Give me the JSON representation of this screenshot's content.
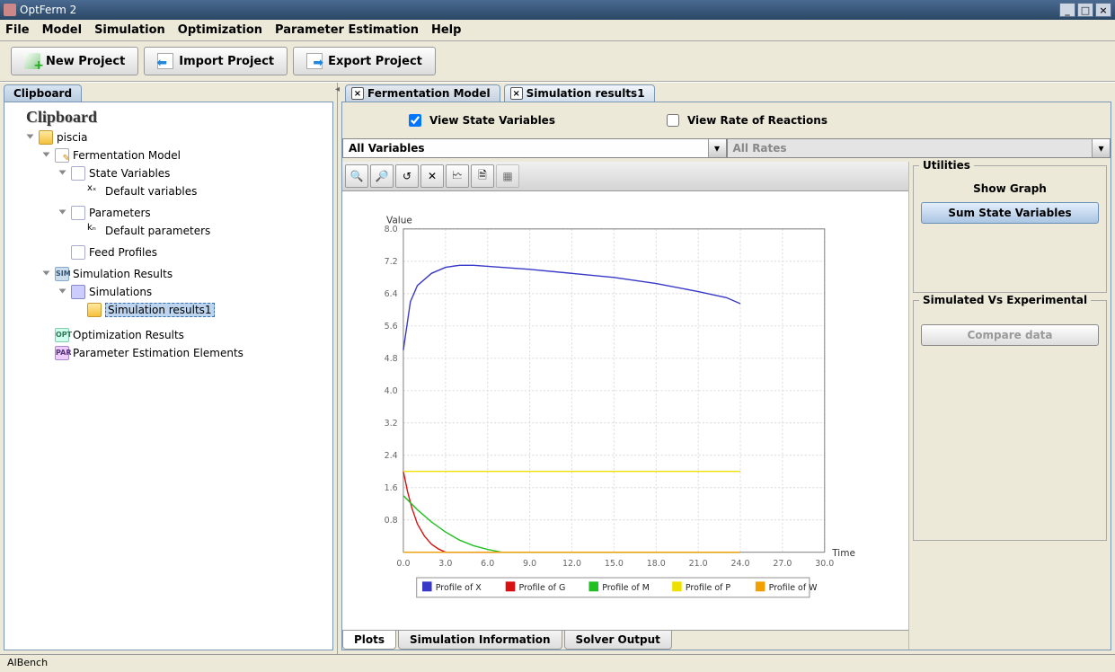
{
  "window": {
    "title": "OptFerm 2"
  },
  "menu": {
    "file": "File",
    "model": "Model",
    "simulation": "Simulation",
    "optimization": "Optimization",
    "param_est": "Parameter Estimation",
    "help": "Help"
  },
  "toolbar": {
    "new_project": "New Project",
    "import_project": "Import Project",
    "export_project": "Export Project"
  },
  "sidebar": {
    "tab": "Clipboard",
    "header": "Clipboard",
    "tree": {
      "root": "piscia",
      "fermentation_model": "Fermentation Model",
      "state_variables": "State Variables",
      "default_variables": "Default variables",
      "parameters": "Parameters",
      "default_parameters": "Default parameters",
      "feed_profiles": "Feed Profiles",
      "simulation_results": "Simulation Results",
      "simulations": "Simulations",
      "simulation_results1": "Simulation results1",
      "optimization_results": "Optimization Results",
      "param_est_elements": "Parameter Estimation Elements"
    }
  },
  "main": {
    "tabs": {
      "fermentation_model": "Fermentation Model",
      "simulation_results1": "Simulation results1"
    },
    "view_state_variables": "View State Variables",
    "view_rate_reactions": "View Rate of Reactions",
    "all_variables": "All Variables",
    "all_rates": "All Rates"
  },
  "util": {
    "group1": "Utilities",
    "show_graph": "Show Graph",
    "sum_state": "Sum State Variables",
    "group2": "Simulated Vs Experimental",
    "compare": "Compare data"
  },
  "bottom_tabs": {
    "plots": "Plots",
    "sim_info": "Simulation Information",
    "solver_output": "Solver Output"
  },
  "statusbar": "AIBench",
  "chart_data": {
    "type": "line",
    "title": "",
    "xlabel": "Time",
    "ylabel": "Value",
    "xlim": [
      0,
      30
    ],
    "ylim": [
      0,
      8
    ],
    "x_ticks": [
      0.0,
      3.0,
      6.0,
      9.0,
      12.0,
      15.0,
      18.0,
      21.0,
      24.0,
      27.0,
      30.0
    ],
    "y_ticks": [
      0.8,
      1.6,
      2.4,
      3.2,
      4.0,
      4.8,
      5.6,
      6.4,
      7.2,
      8.0
    ],
    "series": [
      {
        "name": "Profile of X",
        "color": "#3838c8",
        "x": [
          0.0,
          0.5,
          1.0,
          2.0,
          3.0,
          4.0,
          5.0,
          7.0,
          9.0,
          12.0,
          15.0,
          18.0,
          21.0,
          23.0,
          24.0
        ],
        "y": [
          5.0,
          6.2,
          6.6,
          6.9,
          7.05,
          7.1,
          7.1,
          7.05,
          7.0,
          6.9,
          6.8,
          6.65,
          6.45,
          6.3,
          6.15
        ]
      },
      {
        "name": "Profile of G",
        "color": "#d81010",
        "x": [
          0.0,
          0.3,
          0.6,
          1.0,
          1.5,
          2.0,
          2.5,
          3.0,
          24.0
        ],
        "y": [
          2.0,
          1.5,
          1.1,
          0.7,
          0.4,
          0.2,
          0.08,
          0.0,
          0.0
        ]
      },
      {
        "name": "Profile of M",
        "color": "#20c020",
        "x": [
          0.0,
          1.0,
          2.0,
          3.0,
          4.0,
          5.0,
          6.0,
          7.0,
          24.0
        ],
        "y": [
          1.4,
          1.05,
          0.75,
          0.5,
          0.3,
          0.16,
          0.07,
          0.0,
          0.0
        ]
      },
      {
        "name": "Profile of P",
        "color": "#f0e000",
        "x": [
          0.0,
          24.0
        ],
        "y": [
          2.0,
          2.0
        ]
      },
      {
        "name": "Profile of W",
        "color": "#f0a000",
        "x": [
          0.0,
          24.0
        ],
        "y": [
          0.0,
          0.0
        ]
      }
    ]
  }
}
